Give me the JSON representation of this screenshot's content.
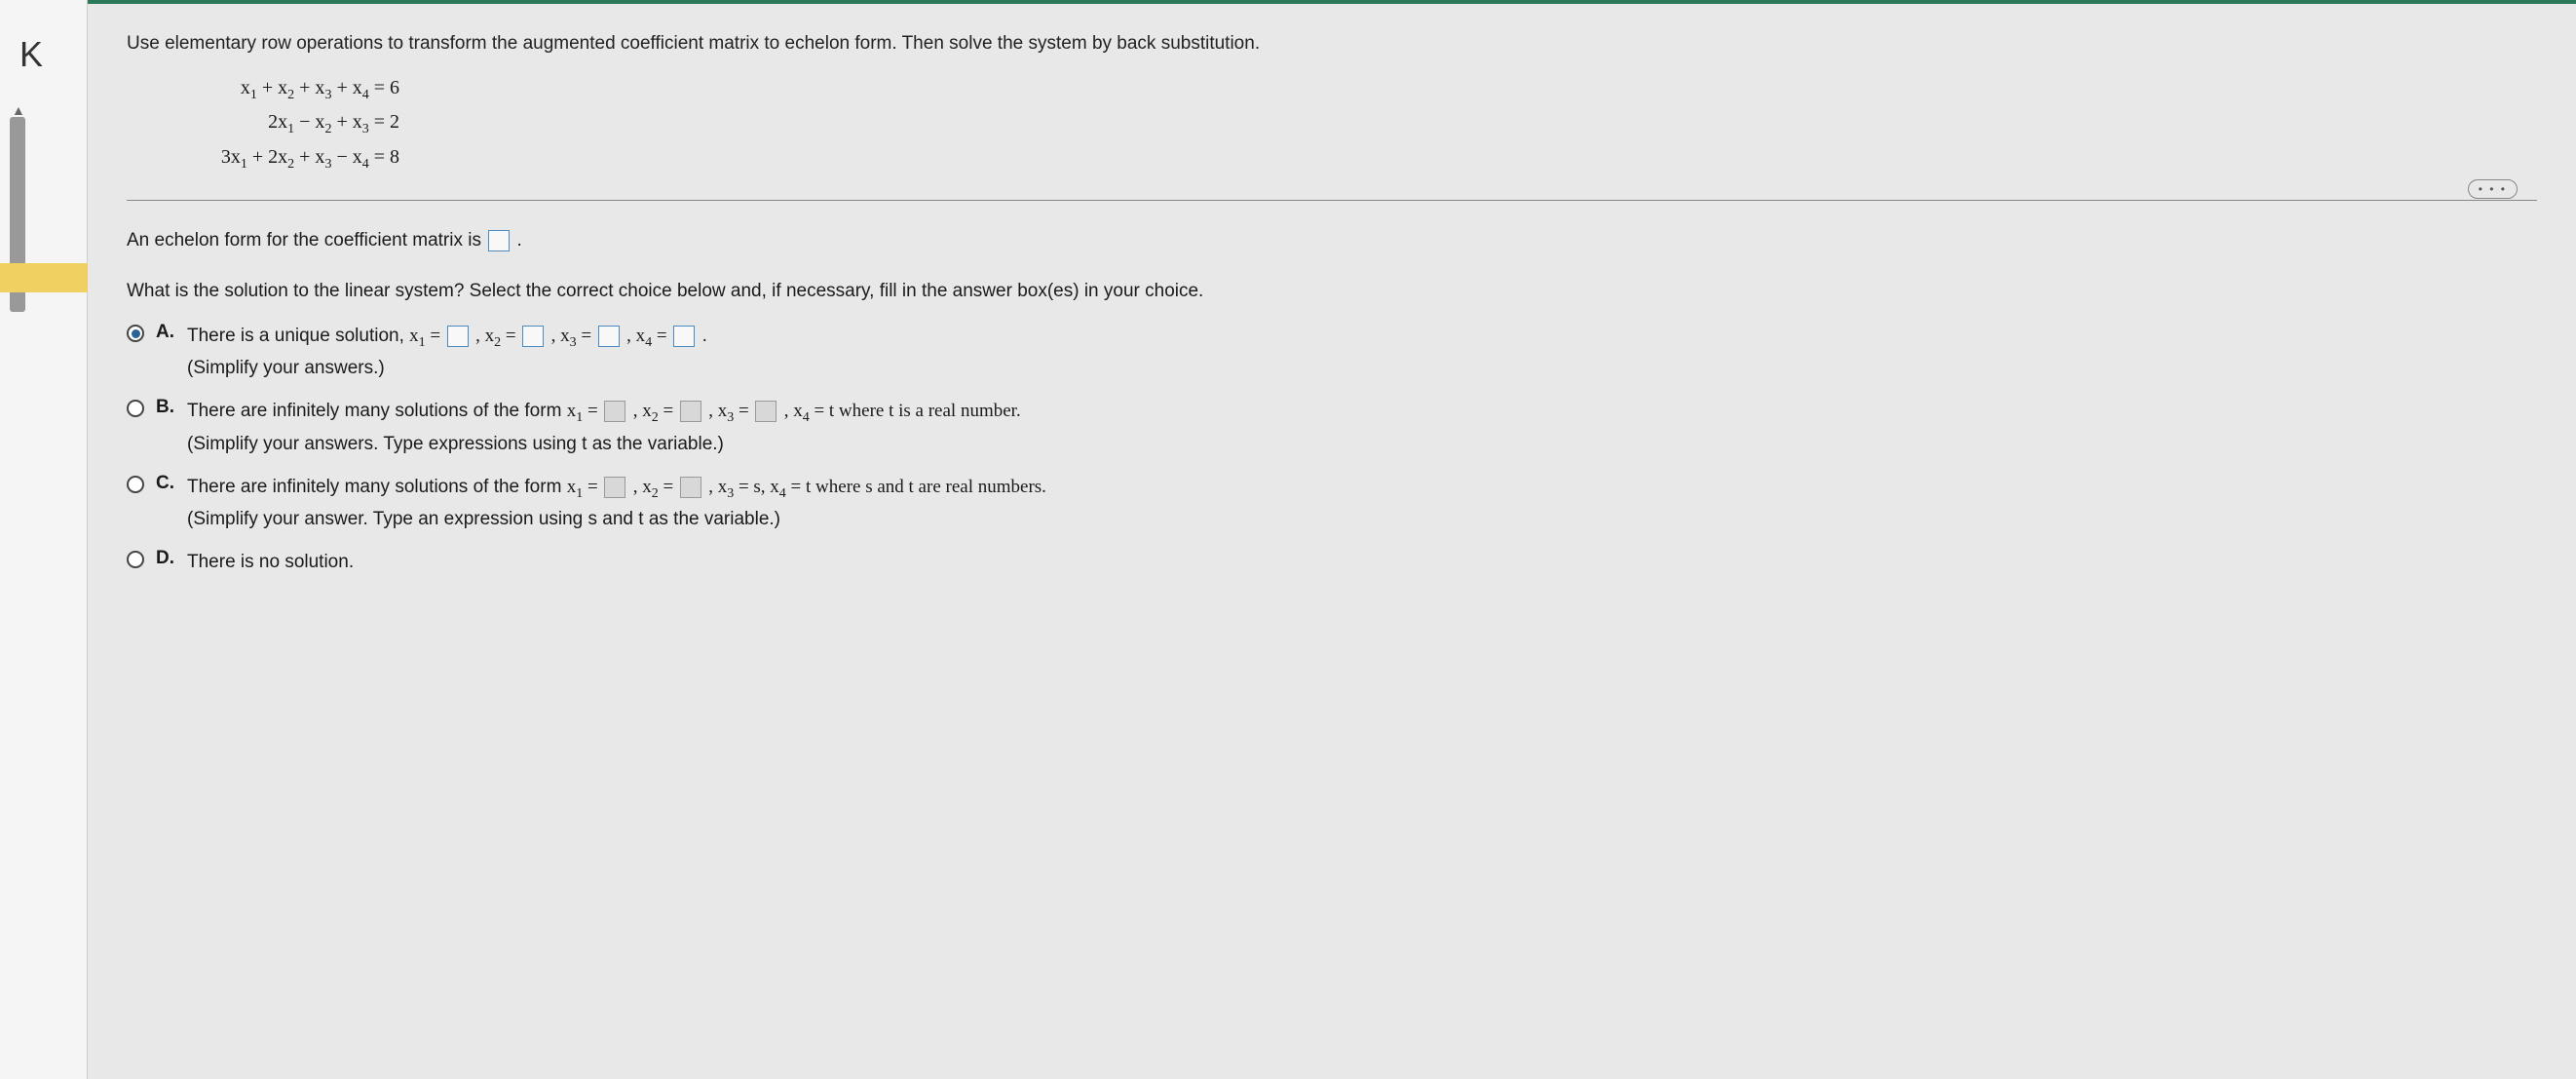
{
  "question": {
    "instruction": "Use elementary row operations to transform the augmented coefficient matrix to echelon form. Then solve the system by back substitution.",
    "equations": {
      "eq1": "x₁ + x₂ + x₃ + x₄ = 6",
      "eq2": "2x₁ − x₂ + x₃ = 2",
      "eq3": "3x₁ + 2x₂ + x₃ − x₄ = 8"
    }
  },
  "more_label": "• • •",
  "prompt1_prefix": "An echelon form for the coefficient matrix is ",
  "prompt1_suffix": ".",
  "prompt2": "What is the solution to the linear system? Select the correct choice below and, if necessary, fill in the answer box(es) in your choice.",
  "choices": {
    "A": {
      "letter": "A.",
      "text_prefix": "There is a unique solution, ",
      "x1_label": "x₁ = ",
      "x2_label": ", x₂ = ",
      "x3_label": ", x₃ = ",
      "x4_label": ", x₄ = ",
      "text_suffix": ".",
      "hint": "(Simplify your answers.)",
      "selected": true
    },
    "B": {
      "letter": "B.",
      "text_prefix": "There are infinitely many solutions of the form ",
      "x1_label": "x₁ = ",
      "x2_label": ", x₂ = ",
      "x3_label": ", x₃ = ",
      "x4_text": ", x₄ = t where t is a real number.",
      "hint": "(Simplify your answers. Type expressions using t as the variable.)",
      "selected": false
    },
    "C": {
      "letter": "C.",
      "text_prefix": "There are infinitely many solutions of the form ",
      "x1_label": "x₁ = ",
      "x2_label": ", x₂ = ",
      "x34_text": ", x₃ = s, x₄ = t where s and t are real numbers.",
      "hint": "(Simplify your answer. Type an expression using s and t as the variable.)",
      "selected": false
    },
    "D": {
      "letter": "D.",
      "text": "There is no solution.",
      "selected": false
    }
  }
}
